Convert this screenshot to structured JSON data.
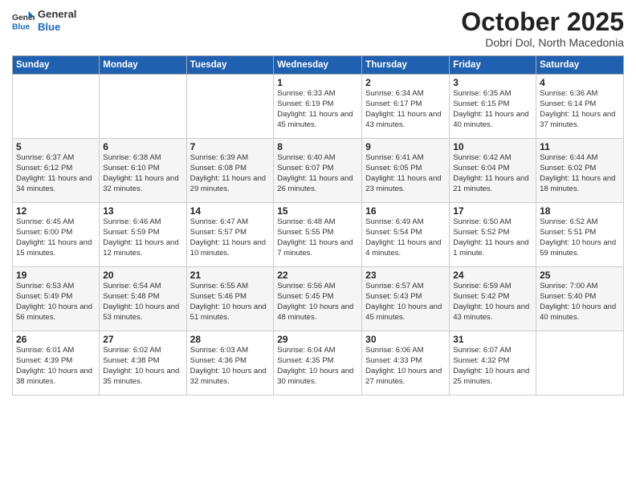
{
  "logo": {
    "general": "General",
    "blue": "Blue"
  },
  "title": "October 2025",
  "subtitle": "Dobri Dol, North Macedonia",
  "headers": [
    "Sunday",
    "Monday",
    "Tuesday",
    "Wednesday",
    "Thursday",
    "Friday",
    "Saturday"
  ],
  "weeks": [
    [
      {
        "day": "",
        "info": ""
      },
      {
        "day": "",
        "info": ""
      },
      {
        "day": "",
        "info": ""
      },
      {
        "day": "1",
        "info": "Sunrise: 6:33 AM\nSunset: 6:19 PM\nDaylight: 11 hours\nand 45 minutes."
      },
      {
        "day": "2",
        "info": "Sunrise: 6:34 AM\nSunset: 6:17 PM\nDaylight: 11 hours\nand 43 minutes."
      },
      {
        "day": "3",
        "info": "Sunrise: 6:35 AM\nSunset: 6:15 PM\nDaylight: 11 hours\nand 40 minutes."
      },
      {
        "day": "4",
        "info": "Sunrise: 6:36 AM\nSunset: 6:14 PM\nDaylight: 11 hours\nand 37 minutes."
      }
    ],
    [
      {
        "day": "5",
        "info": "Sunrise: 6:37 AM\nSunset: 6:12 PM\nDaylight: 11 hours\nand 34 minutes."
      },
      {
        "day": "6",
        "info": "Sunrise: 6:38 AM\nSunset: 6:10 PM\nDaylight: 11 hours\nand 32 minutes."
      },
      {
        "day": "7",
        "info": "Sunrise: 6:39 AM\nSunset: 6:08 PM\nDaylight: 11 hours\nand 29 minutes."
      },
      {
        "day": "8",
        "info": "Sunrise: 6:40 AM\nSunset: 6:07 PM\nDaylight: 11 hours\nand 26 minutes."
      },
      {
        "day": "9",
        "info": "Sunrise: 6:41 AM\nSunset: 6:05 PM\nDaylight: 11 hours\nand 23 minutes."
      },
      {
        "day": "10",
        "info": "Sunrise: 6:42 AM\nSunset: 6:04 PM\nDaylight: 11 hours\nand 21 minutes."
      },
      {
        "day": "11",
        "info": "Sunrise: 6:44 AM\nSunset: 6:02 PM\nDaylight: 11 hours\nand 18 minutes."
      }
    ],
    [
      {
        "day": "12",
        "info": "Sunrise: 6:45 AM\nSunset: 6:00 PM\nDaylight: 11 hours\nand 15 minutes."
      },
      {
        "day": "13",
        "info": "Sunrise: 6:46 AM\nSunset: 5:59 PM\nDaylight: 11 hours\nand 12 minutes."
      },
      {
        "day": "14",
        "info": "Sunrise: 6:47 AM\nSunset: 5:57 PM\nDaylight: 11 hours\nand 10 minutes."
      },
      {
        "day": "15",
        "info": "Sunrise: 6:48 AM\nSunset: 5:55 PM\nDaylight: 11 hours\nand 7 minutes."
      },
      {
        "day": "16",
        "info": "Sunrise: 6:49 AM\nSunset: 5:54 PM\nDaylight: 11 hours\nand 4 minutes."
      },
      {
        "day": "17",
        "info": "Sunrise: 6:50 AM\nSunset: 5:52 PM\nDaylight: 11 hours\nand 1 minute."
      },
      {
        "day": "18",
        "info": "Sunrise: 6:52 AM\nSunset: 5:51 PM\nDaylight: 10 hours\nand 59 minutes."
      }
    ],
    [
      {
        "day": "19",
        "info": "Sunrise: 6:53 AM\nSunset: 5:49 PM\nDaylight: 10 hours\nand 56 minutes."
      },
      {
        "day": "20",
        "info": "Sunrise: 6:54 AM\nSunset: 5:48 PM\nDaylight: 10 hours\nand 53 minutes."
      },
      {
        "day": "21",
        "info": "Sunrise: 6:55 AM\nSunset: 5:46 PM\nDaylight: 10 hours\nand 51 minutes."
      },
      {
        "day": "22",
        "info": "Sunrise: 6:56 AM\nSunset: 5:45 PM\nDaylight: 10 hours\nand 48 minutes."
      },
      {
        "day": "23",
        "info": "Sunrise: 6:57 AM\nSunset: 5:43 PM\nDaylight: 10 hours\nand 45 minutes."
      },
      {
        "day": "24",
        "info": "Sunrise: 6:59 AM\nSunset: 5:42 PM\nDaylight: 10 hours\nand 43 minutes."
      },
      {
        "day": "25",
        "info": "Sunrise: 7:00 AM\nSunset: 5:40 PM\nDaylight: 10 hours\nand 40 minutes."
      }
    ],
    [
      {
        "day": "26",
        "info": "Sunrise: 6:01 AM\nSunset: 4:39 PM\nDaylight: 10 hours\nand 38 minutes."
      },
      {
        "day": "27",
        "info": "Sunrise: 6:02 AM\nSunset: 4:38 PM\nDaylight: 10 hours\nand 35 minutes."
      },
      {
        "day": "28",
        "info": "Sunrise: 6:03 AM\nSunset: 4:36 PM\nDaylight: 10 hours\nand 32 minutes."
      },
      {
        "day": "29",
        "info": "Sunrise: 6:04 AM\nSunset: 4:35 PM\nDaylight: 10 hours\nand 30 minutes."
      },
      {
        "day": "30",
        "info": "Sunrise: 6:06 AM\nSunset: 4:33 PM\nDaylight: 10 hours\nand 27 minutes."
      },
      {
        "day": "31",
        "info": "Sunrise: 6:07 AM\nSunset: 4:32 PM\nDaylight: 10 hours\nand 25 minutes."
      },
      {
        "day": "",
        "info": ""
      }
    ]
  ]
}
